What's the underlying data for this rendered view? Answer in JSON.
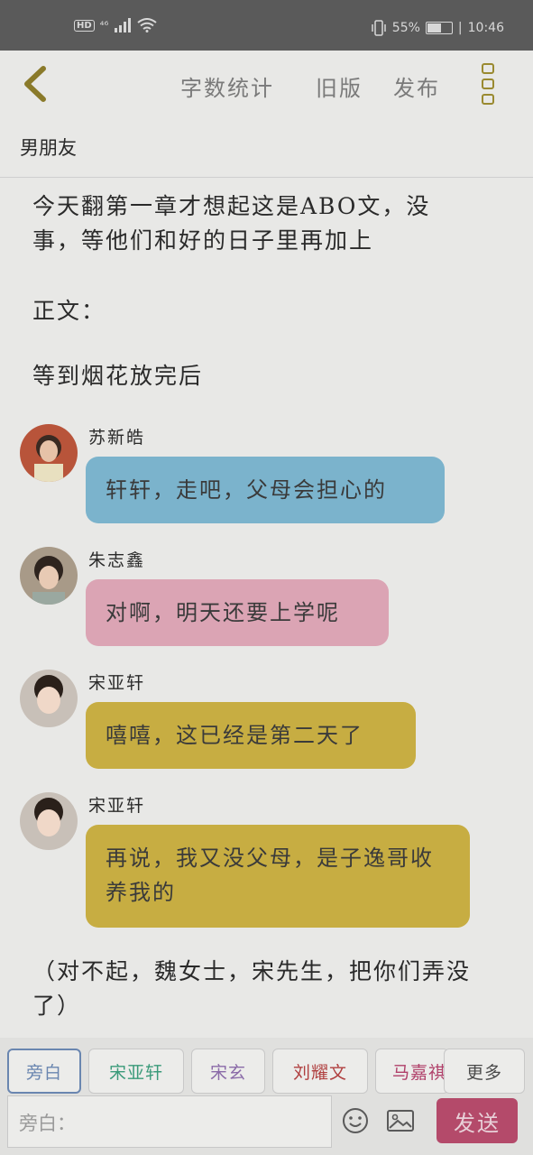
{
  "status_bar": {
    "hd": "HD",
    "network": "⁴⁶",
    "battery_percent": "55%",
    "battery_level": 0.55,
    "time": "10:46"
  },
  "toolbar": {
    "word_count": "字数统计",
    "old_version": "旧版",
    "publish": "发布",
    "back_icon": "chevron-left-icon",
    "more_icon": "more-vertical-icon"
  },
  "chapter": {
    "title": "男朋友"
  },
  "paragraphs": [
    "今天翻第一章才想起这是ABO文，没事，等他们和好的日子里再加上",
    "正文：",
    "等到烟花放完后",
    "（对不起，魏女士，宋先生，把你们弄没了）"
  ],
  "messages": [
    {
      "speaker": "苏新皓",
      "text": "轩轩，走吧，父母会担心的",
      "color": "#7bb3cc"
    },
    {
      "speaker": "朱志鑫",
      "text": "对啊，明天还要上学呢",
      "color": "#dba4b4"
    },
    {
      "speaker": "宋亚轩",
      "text": "嘻嘻，这已经是第二天了",
      "color": "#c7ad42"
    },
    {
      "speaker": "宋亚轩",
      "text": "再说，我又没父母，是子逸哥收养我的",
      "color": "#c7ad42"
    }
  ],
  "tabs": [
    {
      "label": "旁白",
      "color": "#6a86b0"
    },
    {
      "label": "宋亚轩",
      "color": "#3a9a7a"
    },
    {
      "label": "宋玄",
      "color": "#8a6aa8"
    },
    {
      "label": "刘耀文",
      "color": "#b04040"
    },
    {
      "label": "马嘉祺",
      "color": "#b0406a"
    },
    {
      "label": "更多",
      "color": "#4a4a4a"
    }
  ],
  "input": {
    "placeholder": "旁白："
  },
  "send_label": "发送",
  "icons": {
    "emoji": "smiley-icon",
    "image": "image-icon"
  }
}
